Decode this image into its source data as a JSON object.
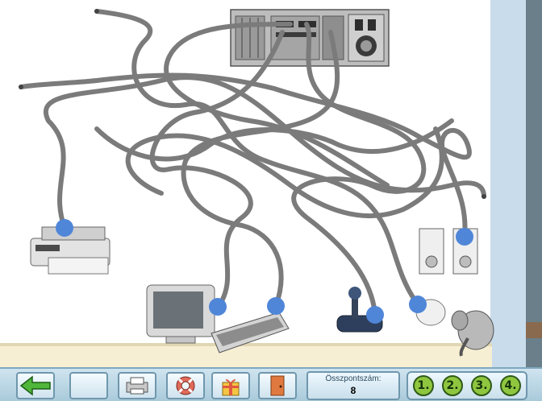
{
  "toolbar": {
    "back_icon": "arrow-left-icon",
    "empty_icon": "blank-slot",
    "print_icon": "printer-icon",
    "help_icon": "lifebuoy-icon",
    "gift_icon": "gift-icon",
    "door_icon": "door-icon",
    "score_label": "Összpontszám:",
    "score_value": "8",
    "levels": [
      "1.",
      "2.",
      "3.",
      "4."
    ]
  },
  "board": {
    "devices": [
      "printer",
      "monitor",
      "keyboard",
      "joystick",
      "mouse",
      "speakers",
      "pc-tower",
      "elephant-mascot"
    ],
    "accent_dot_color": "#4f86d8",
    "cable_color": "#7b7b7b"
  }
}
